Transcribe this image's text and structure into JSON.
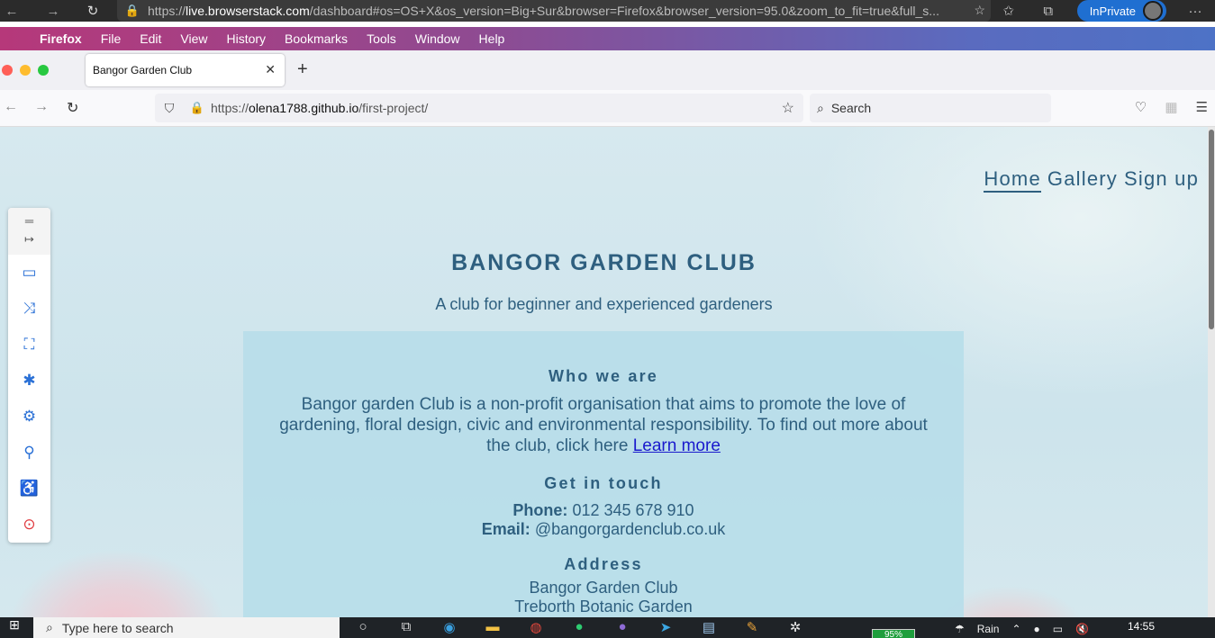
{
  "edge": {
    "url_prefix": "https://",
    "url_host": "live.browserstack.com",
    "url_rest": "/dashboard#os=OS+X&os_version=Big+Sur&browser=Firefox&browser_version=95.0&zoom_to_fit=true&full_s...",
    "inprivate_label": "InPrivate"
  },
  "menubar": {
    "app": "Firefox",
    "items": [
      "File",
      "Edit",
      "View",
      "History",
      "Bookmarks",
      "Tools",
      "Window",
      "Help"
    ]
  },
  "firefox": {
    "tab_title": "Bangor Garden Club",
    "url_prefix": "https://",
    "url_host": "olena1788.github.io",
    "url_path": "/first-project/",
    "search_placeholder": "Search"
  },
  "site": {
    "nav": [
      "Home",
      "Gallery",
      "Sign up"
    ],
    "title": "BANGOR GARDEN CLUB",
    "subtitle": "A club for beginner and experienced gardeners",
    "who_heading": "Who we are",
    "who_text": "Bangor garden Club is a non-profit organisation that aims to promote the love of gardening, floral design, civic and environmental responsibility. To find out more about the club, click here",
    "learn_more": "Learn more",
    "touch_heading": "Get in touch",
    "phone_label": "Phone:",
    "phone_value": "012 345 678 910",
    "email_label": "Email:",
    "email_value": "@bangorgardenclub.co.uk",
    "address_heading": "Address",
    "address_line1": "Bangor Garden Club",
    "address_line2": "Treborth Botanic Garden"
  },
  "taskbar": {
    "search_placeholder": "Type here to search",
    "battery": "95%",
    "weather": "Rain",
    "time": "14:55"
  }
}
